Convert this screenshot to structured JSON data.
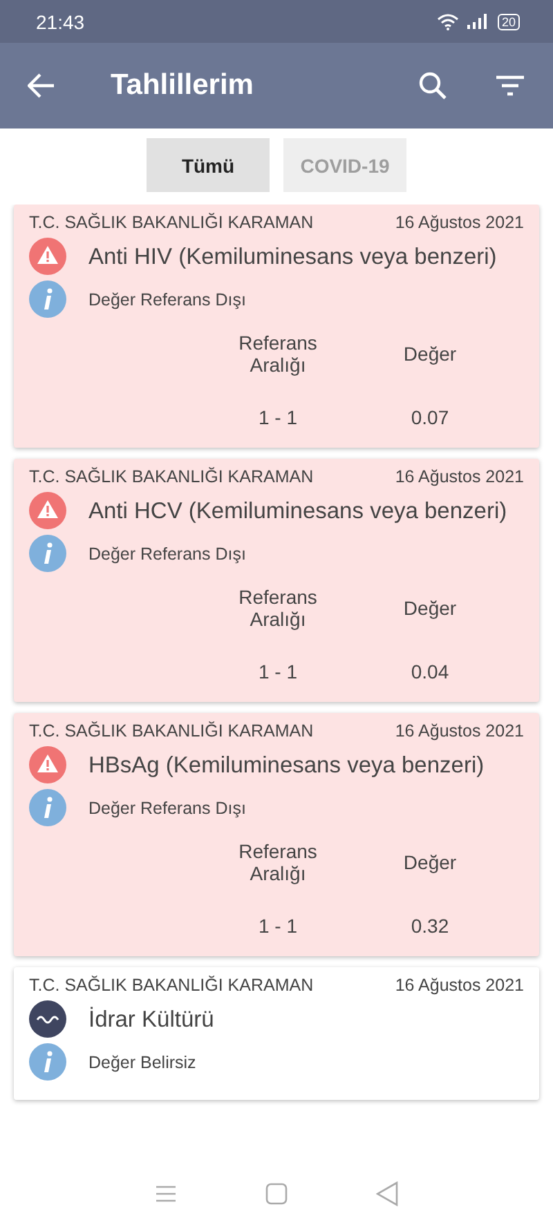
{
  "status_bar": {
    "time": "21:43",
    "battery": "20"
  },
  "app_bar": {
    "title": "Tahlillerim"
  },
  "filters": [
    {
      "label": "Tümü",
      "selected": true
    },
    {
      "label": "COVID-19",
      "selected": false
    }
  ],
  "results": [
    {
      "kind": "out_of_range",
      "institution": "T.C. SAĞLIK BAKANLIĞI KARAMAN",
      "date": "16 Ağustos 2021",
      "test": "Anti HIV (Kemiluminesans veya benzeri)",
      "note": "Değer Referans Dışı",
      "range_header": "Referans Aralığı",
      "value_header": "Değer",
      "range": "1 - 1",
      "value": "0.07"
    },
    {
      "kind": "out_of_range",
      "institution": "T.C. SAĞLIK BAKANLIĞI KARAMAN",
      "date": "16 Ağustos 2021",
      "test": "Anti HCV (Kemiluminesans veya benzeri)",
      "note": "Değer Referans Dışı",
      "range_header": "Referans Aralığı",
      "value_header": "Değer",
      "range": "1 - 1",
      "value": "0.04"
    },
    {
      "kind": "out_of_range",
      "institution": "T.C. SAĞLIK BAKANLIĞI KARAMAN",
      "date": "16 Ağustos 2021",
      "test": "HBsAg (Kemiluminesans veya benzeri)",
      "note": "Değer Referans Dışı",
      "range_header": "Referans Aralığı",
      "value_header": "Değer",
      "range": "1 - 1",
      "value": "0.32"
    },
    {
      "kind": "unknown",
      "institution": "T.C. SAĞLIK BAKANLIĞI KARAMAN",
      "date": "16 Ağustos 2021",
      "test": "İdrar Kültürü",
      "note": "Değer Belirsiz"
    }
  ]
}
